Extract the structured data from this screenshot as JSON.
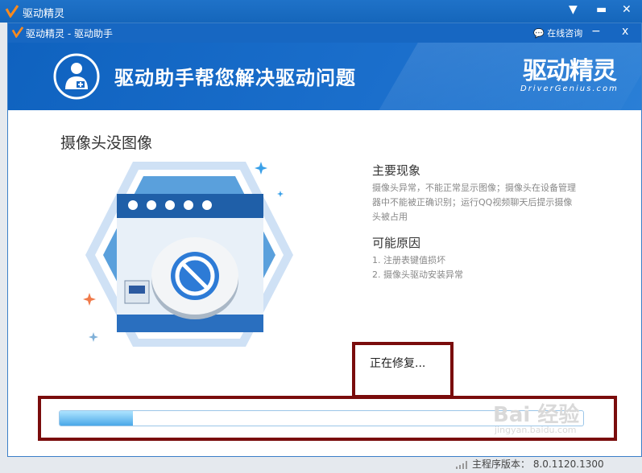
{
  "outer_window": {
    "title": "驱动精灵"
  },
  "dialog": {
    "title": "驱动精灵 - 驱动助手",
    "consult_label": "在线咨询",
    "minimize_label": "−",
    "close_label": "x"
  },
  "banner": {
    "headline": "驱动助手帮您解决驱动问题",
    "brand_cn": "驱动精灵",
    "brand_en": "DriverGenius.com"
  },
  "problem_title": "摄像头没图像",
  "symptoms": {
    "title": "主要现象",
    "lines": [
      "摄像头异常，不能正常显示图像；摄像头在设备管理",
      "器中不能被正确识别；运行QQ视频聊天后提示摄像",
      "头被占用"
    ]
  },
  "causes": {
    "title": "可能原因",
    "items": [
      "1. 注册表键值损坏",
      "2. 摄像头驱动安装异常"
    ]
  },
  "status": {
    "text": "正在修复..."
  },
  "progress": {
    "value": 0.14
  },
  "footer": {
    "version_text": "主程序版本： 8.0.1120.1300"
  },
  "watermark": {
    "text": "Bai 经验",
    "sub": "jingyan.baidu.com"
  },
  "colors": {
    "accent": "#1767c2",
    "highlight_border": "#7a0c0c",
    "progress_fill": "#4aa8e8"
  }
}
